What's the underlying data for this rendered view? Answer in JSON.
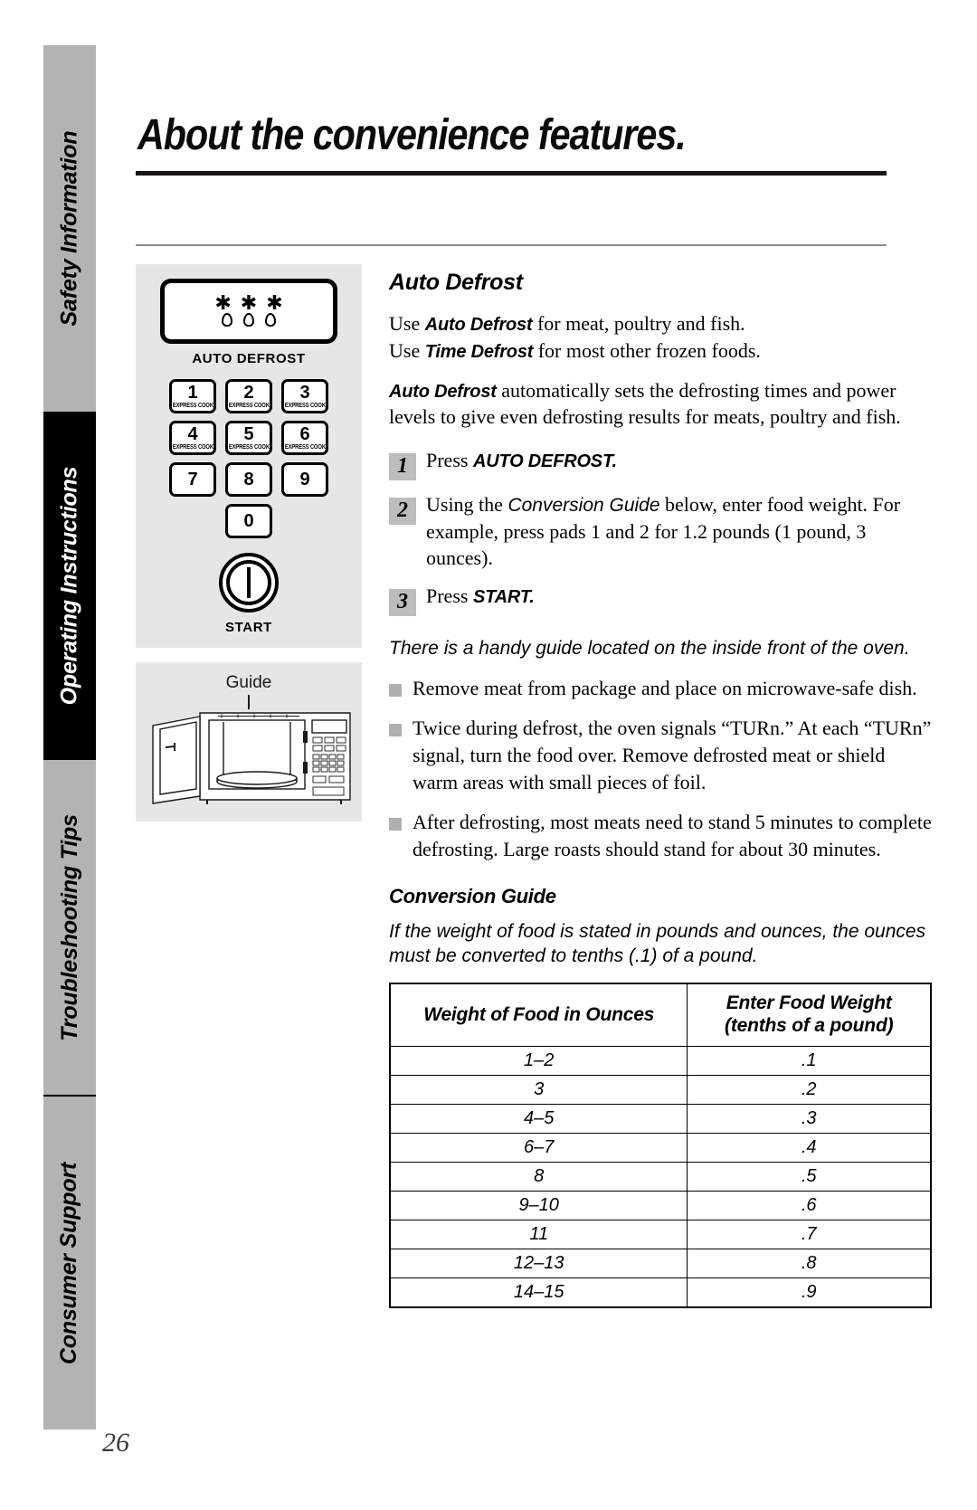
{
  "sidebar": {
    "tabs": [
      {
        "label": "Safety Information",
        "active": false
      },
      {
        "label": "Operating Instructions",
        "active": true
      },
      {
        "label": "Troubleshooting Tips",
        "active": false
      },
      {
        "label": "Consumer Support",
        "active": false
      }
    ]
  },
  "page": {
    "title": "About the convenience features.",
    "number": "26"
  },
  "control_panel": {
    "defrost_button_caption": "AUTO DEFROST",
    "keys": [
      {
        "num": "1",
        "sub": "EXPRESS COOK"
      },
      {
        "num": "2",
        "sub": "EXPRESS COOK"
      },
      {
        "num": "3",
        "sub": "EXPRESS COOK"
      },
      {
        "num": "4",
        "sub": "EXPRESS COOK"
      },
      {
        "num": "5",
        "sub": "EXPRESS COOK"
      },
      {
        "num": "6",
        "sub": "EXPRESS COOK"
      },
      {
        "num": "7",
        "sub": ""
      },
      {
        "num": "8",
        "sub": ""
      },
      {
        "num": "9",
        "sub": ""
      }
    ],
    "zero_key": {
      "num": "0",
      "sub": ""
    },
    "start_caption": "START"
  },
  "oven_illustration": {
    "callout_label": "Guide"
  },
  "section": {
    "heading": "Auto Defrost",
    "intro_line1_pre": "Use ",
    "intro_line1_bold": "Auto Defrost",
    "intro_line1_post": " for meat, poultry and fish.",
    "intro_line2_pre": "Use ",
    "intro_line2_bold": "Time Defrost",
    "intro_line2_post": " for most other frozen foods.",
    "para_bold": "Auto Defrost",
    "para_rest": " automatically sets the defrosting times and power levels to give even defrosting results for meats, poultry and fish.",
    "steps": [
      {
        "number": "1",
        "text_pre": "Press ",
        "text_bold": "AUTO DEFROST.",
        "text_post": ""
      },
      {
        "number": "2",
        "text_pre": "Using the ",
        "text_italic": "Conversion Guide",
        "text_post": " below, enter food weight. For example, press pads 1 and 2 for 1.2 pounds (1 pound, 3 ounces)."
      },
      {
        "number": "3",
        "text_pre": "Press ",
        "text_bold": "START.",
        "text_post": ""
      }
    ],
    "guide_note": "There is a handy guide located on the inside front of the oven.",
    "bullets": [
      "Remove meat from package and place on microwave-safe dish.",
      "Twice during defrost, the oven signals “TURn.” At each “TURn” signal, turn the food over. Remove defrosted meat or shield warm areas with small pieces of foil.",
      "After defrosting, most meats need to stand 5 minutes to complete defrosting. Large roasts should stand for about 30 minutes."
    ]
  },
  "conversion_guide": {
    "heading": "Conversion Guide",
    "intro": "If the weight of food is stated in pounds and ounces, the ounces must be converted to tenths (.1) of a pound.",
    "table": {
      "headers": [
        "Weight of Food in Ounces",
        "Enter Food Weight\n(tenths of a pound)"
      ],
      "header_col2_line1": "Enter Food Weight",
      "header_col2_line2": "(tenths of a pound)",
      "rows": [
        [
          "1–2",
          ".1"
        ],
        [
          "3",
          ".2"
        ],
        [
          "4–5",
          ".3"
        ],
        [
          "6–7",
          ".4"
        ],
        [
          "8",
          ".5"
        ],
        [
          "9–10",
          ".6"
        ],
        [
          "11",
          ".7"
        ],
        [
          "12–13",
          ".8"
        ],
        [
          "14–15",
          ".9"
        ]
      ]
    }
  },
  "colors": {
    "tab_inactive": "#b3b3b3",
    "tab_active": "#000000",
    "panel_bg": "#e6e6e6",
    "step_badge": "#bdbdbd",
    "bullet": "#b0b0b0"
  }
}
